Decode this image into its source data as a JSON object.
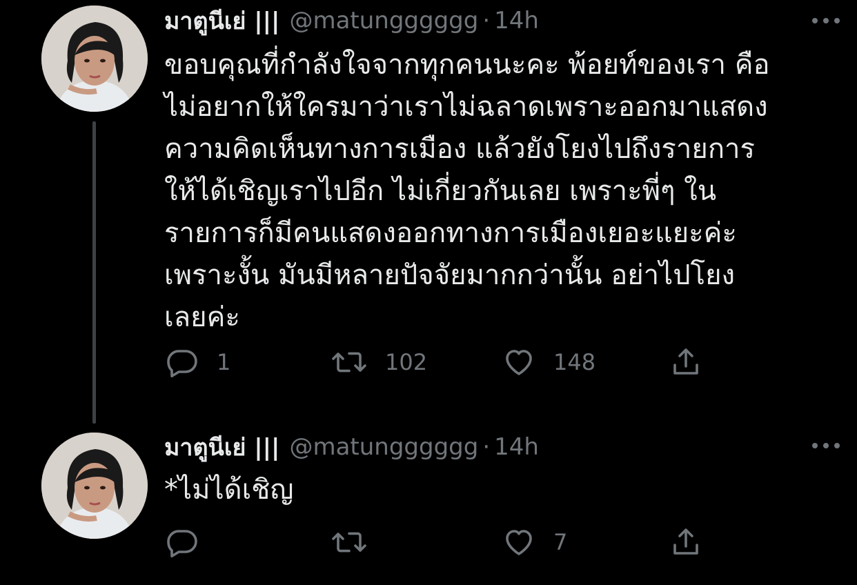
{
  "tweets": [
    {
      "display_name": "มาตูนีเย่ |||",
      "handle": "@matungggggg",
      "separator": "·",
      "time": "14h",
      "text_lines": [
        "ขอบคุณที่กำลังใจจากทุกคนนะคะ พ้อยท์ของเรา คือ",
        "ไม่อยากให้ใครมาว่าเราไม่ฉลาดเพราะออกมาแสดง",
        "ความคิดเห็นทางการเมือง แล้วยังโยงไปถึงรายการ",
        "ให้ได้เชิญเราไปอีก ไม่เกี่ยวกันเลย เพราะพี่ๆ ใน",
        "รายการก็มีคนแสดงออกทางการเมืองเยอะแยะค่ะ",
        "เพราะงั้น มันมีหลายปัจจัยมากกว่านั้น อย่าไปโยง",
        "เลยค่ะ"
      ],
      "reply_count": "1",
      "retweet_count": "102",
      "like_count": "148"
    },
    {
      "display_name": "มาตูนีเย่ |||",
      "handle": "@matungggggg",
      "separator": "·",
      "time": "14h",
      "text_lines": [
        "*ไม่ได้เชิญ"
      ],
      "reply_count": "",
      "retweet_count": "",
      "like_count": "7"
    }
  ],
  "icons": {
    "more": "more-horizontal-icon",
    "reply": "reply-icon",
    "retweet": "retweet-icon",
    "like": "heart-icon",
    "share": "share-icon"
  },
  "colors": {
    "background": "#000000",
    "primary_text": "#e7e9ea",
    "secondary_text": "#71767b",
    "thread_line": "#3d4145"
  }
}
